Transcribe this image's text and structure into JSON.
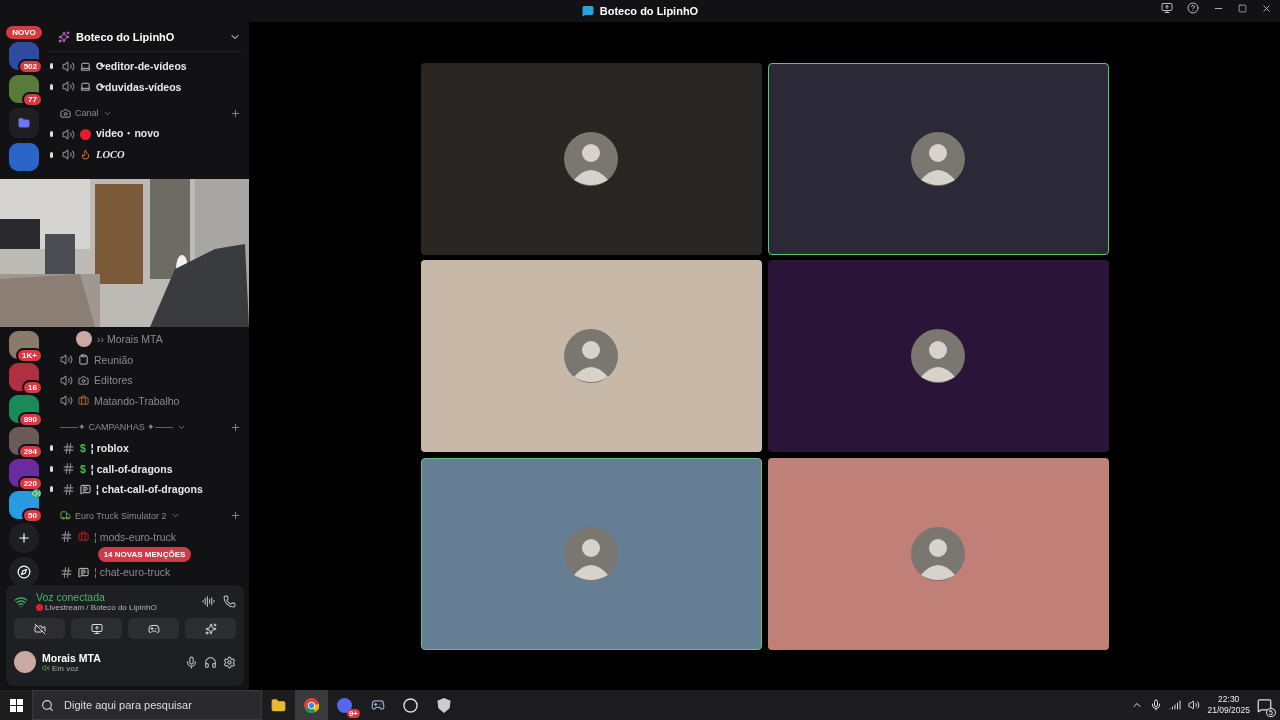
{
  "window": {
    "title": "Boteco do LipinhO"
  },
  "servers_top": [
    {
      "kind": "server",
      "badge": "502",
      "pill": "NOVO"
    },
    {
      "kind": "server",
      "badge": "77"
    },
    {
      "kind": "folder"
    },
    {
      "kind": "server"
    }
  ],
  "servers_bottom": [
    {
      "kind": "server",
      "badge": "1K+"
    },
    {
      "kind": "server",
      "badge": "16"
    },
    {
      "kind": "server",
      "badge": "890"
    },
    {
      "kind": "server",
      "badge": "294"
    },
    {
      "kind": "server",
      "badge": "220"
    },
    {
      "kind": "server",
      "badge": "50",
      "speaker": true
    },
    {
      "kind": "add"
    },
    {
      "kind": "discover"
    }
  ],
  "server_name": "Boteco do LipinhO",
  "channels_top": [
    {
      "kind": "voice",
      "name": "⟳editor-de-vídeos"
    },
    {
      "kind": "voice",
      "name": "⟳duvidas-vídeos"
    },
    {
      "kind": "category",
      "name": "Canal"
    },
    {
      "kind": "voice",
      "name": "video・novo"
    },
    {
      "kind": "voice",
      "name": "LOCO",
      "fancy": true
    }
  ],
  "channels_bottom": [
    {
      "kind": "user",
      "name": "›› Morais MTA"
    },
    {
      "kind": "voice",
      "name": "Reunião",
      "muted": true
    },
    {
      "kind": "voice",
      "name": "Editores",
      "muted": true
    },
    {
      "kind": "voice",
      "name": "Matando-Trabalho",
      "muted": true
    },
    {
      "kind": "category",
      "name": "——✦ CAMPANHAS ✦——"
    },
    {
      "kind": "text",
      "prefix": "$",
      "name": "¦ roblox"
    },
    {
      "kind": "text",
      "prefix": "$",
      "name": "¦ call-of-dragons"
    },
    {
      "kind": "text",
      "name": "¦ chat-call-of-dragons"
    },
    {
      "kind": "category",
      "name": "Euro Truck Simulator 2"
    },
    {
      "kind": "text",
      "name": "¦ mods-euro-truck",
      "muted": true
    },
    {
      "kind": "text",
      "name": "¦ chat-euro-truck",
      "muted": true
    }
  ],
  "mentions_badge": "14 NOVAS MENÇÕES",
  "voice": {
    "status": "Voz conectada",
    "location": "Livestream / Boteco do LipinhO"
  },
  "user": {
    "name": "Morais MTA",
    "status": "Em voz"
  },
  "tiles": [
    {
      "color": "#292523",
      "speaking": false
    },
    {
      "color": "#2b2838",
      "speaking": true
    },
    {
      "color": "#c8b8a8",
      "speaking": false
    },
    {
      "color": "#2a1538",
      "speaking": false
    },
    {
      "color": "#667e94",
      "speaking": true
    },
    {
      "color": "#c08078",
      "speaking": false
    }
  ],
  "taskbar": {
    "search_placeholder": "Digite aqui para pesquisar",
    "discord_badge": "9+",
    "time": "22:30",
    "date": "21/09/2025",
    "notifications": "5"
  }
}
